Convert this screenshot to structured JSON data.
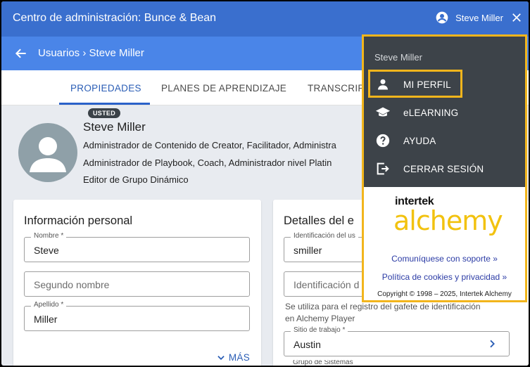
{
  "topbar": {
    "title": "Centro de administración: Bunce & Bean",
    "user_name": "Steve Miller"
  },
  "subbar": {
    "breadcrumb": "Usuarios › Steve Miller"
  },
  "tabs": [
    {
      "label": "PROPIEDADES",
      "active": true
    },
    {
      "label": "PLANES DE APRENDIZAJE",
      "active": false
    },
    {
      "label": "TRANSCRIP",
      "active": false
    }
  ],
  "profile": {
    "badge": "USTED",
    "name": "Steve Miller",
    "roles": [
      "Administrador de Contenido de Creator, Facilitador, Administra",
      "Administrador de Playbook, Coach, Administrador nivel Platin",
      "Editor de Grupo Dinámico"
    ]
  },
  "personal_info": {
    "title": "Información personal",
    "first_name_label": "Nombre *",
    "first_name_value": "Steve",
    "middle_name_placeholder": "Segundo nombre",
    "last_name_label": "Apellido *",
    "last_name_value": "Miller",
    "more_label": "MÁS"
  },
  "employment": {
    "title": "Detalles del e",
    "id_label": "Identificación del us",
    "id_value": "smiller",
    "badge_id_placeholder": "Identificación d",
    "note_line1": "Se utiliza para el registro del gafete de identificación",
    "note_line2": "en Alchemy Player",
    "site_label": "Sitio de trabajo *",
    "site_value": "Austin",
    "next_label": "Grupo de Sistemas"
  },
  "menu": {
    "user_name": "Steve Miller",
    "items": [
      {
        "label": "MI PERFIL",
        "icon": "person-icon"
      },
      {
        "label": "eLEARNING",
        "icon": "graduation-cap-icon"
      },
      {
        "label": "AYUDA",
        "icon": "help-icon"
      },
      {
        "label": "CERRAR SESIÓN",
        "icon": "logout-icon"
      }
    ],
    "logo_top": "intertek",
    "logo_main": "alchemy",
    "support_link": "Comuníquese con soporte »",
    "cookies_link": "Política de cookies y privacidad »",
    "copyright": "Copyright © 1998 – 2025, Intertek Alchemy"
  },
  "colors": {
    "topbar": "#3a6fce",
    "subbar": "#4a85e8",
    "accent": "#2a5db5",
    "highlight": "#f2b51c",
    "menu_dark": "#3d4349",
    "logo_yellow": "#f2c20f"
  }
}
